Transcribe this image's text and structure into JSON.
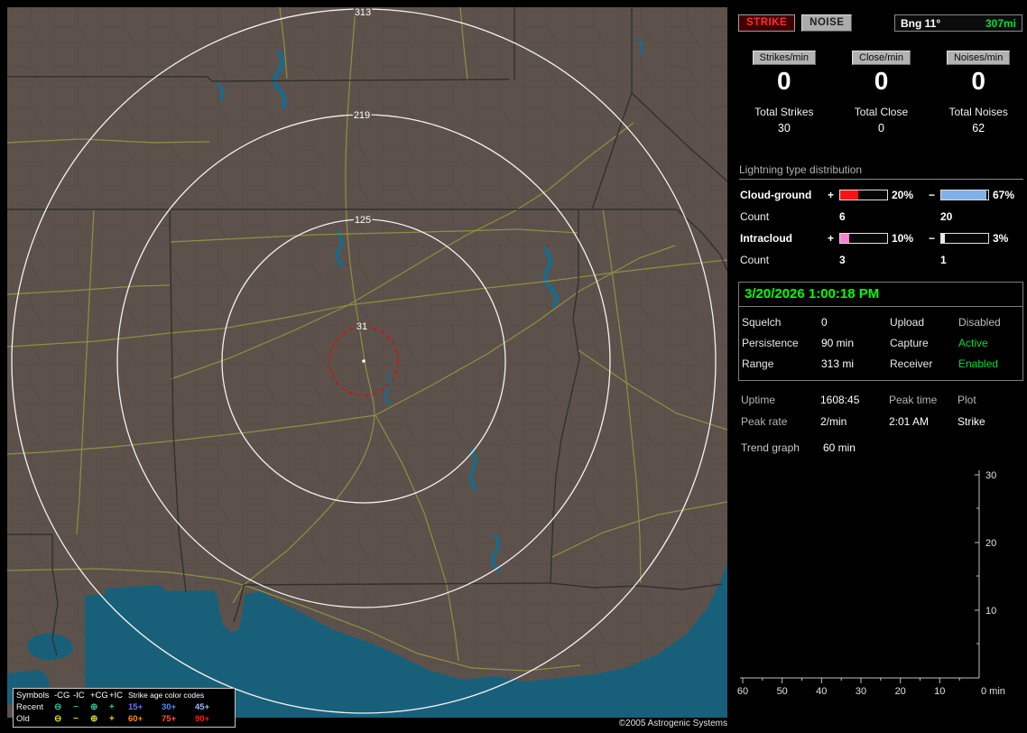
{
  "map": {
    "ring_labels": [
      "313",
      "219",
      "125",
      "31"
    ],
    "copyright": "©2005 Astrogenic Systems",
    "legend": {
      "symbols_header": "Symbols",
      "columns": [
        "-CG",
        "-IC",
        "+CG",
        "+IC"
      ],
      "age_header": "Strike age color codes",
      "symbols": [
        "⊖",
        "−",
        "⊕",
        "+"
      ],
      "rows": [
        {
          "label": "Recent",
          "symbol_color": "#2fbf8f",
          "ages": [
            {
              "text": "15+",
              "color": "#6f6fff"
            },
            {
              "text": "30+",
              "color": "#4a8cff"
            },
            {
              "text": "45+",
              "color": "#9fb9ff"
            }
          ]
        },
        {
          "label": "Old",
          "symbol_color": "#d6d62a",
          "ages": [
            {
              "text": "60+",
              "color": "#ff8c1a"
            },
            {
              "text": "75+",
              "color": "#ff5533"
            },
            {
              "text": "90+",
              "color": "#ff1a1a"
            }
          ]
        }
      ]
    }
  },
  "panel": {
    "strike_button": "STRIKE",
    "noise_button": "NOISE",
    "bearing_label": "Bng 11°",
    "bearing_distance": "307mi",
    "rate_columns": [
      {
        "button": "Strikes/min",
        "value": "0",
        "total_label": "Total Strikes",
        "total_value": "30"
      },
      {
        "button": "Close/min",
        "value": "0",
        "total_label": "Total Close",
        "total_value": "0"
      },
      {
        "button": "Noises/min",
        "value": "0",
        "total_label": "Total Noises",
        "total_value": "62"
      }
    ],
    "distribution": {
      "title": "Lightning type distribution",
      "count_label": "Count",
      "rows": [
        {
          "label": "Cloud-ground",
          "plus": "+",
          "minus": "−",
          "pos_pct": "20%",
          "neg_pct": "67%",
          "pos_count": "6",
          "neg_count": "20",
          "pos_fill": 38,
          "neg_fill": 97,
          "pos_color": "#ff1111",
          "neg_color": "#7fb2e8"
        },
        {
          "label": "Intracloud",
          "plus": "+",
          "minus": "−",
          "pos_pct": "10%",
          "neg_pct": "3%",
          "pos_count": "3",
          "neg_count": "1",
          "pos_fill": 20,
          "neg_fill": 7,
          "pos_color": "#ff7fd4",
          "neg_color": "#e8e8e8"
        }
      ]
    },
    "timestamp": "3/20/2026 1:00:18 PM",
    "settings": {
      "rows": [
        {
          "label1": "Squelch",
          "value1": "0",
          "value1_color": "#ffffff",
          "label2": "Upload",
          "value2": "Disabled",
          "value2_color": "#bdbdbd"
        },
        {
          "label1": "Persistence",
          "value1": "90 min",
          "value1_color": "#ffffff",
          "label2": "Capture",
          "value2": "Active",
          "value2_color": "#00dd33"
        },
        {
          "label1": "Range",
          "value1": "313 mi",
          "value1_color": "#ffffff",
          "label2": "Receiver",
          "value2": "Enabled",
          "value2_color": "#00dd33"
        }
      ]
    },
    "stats": {
      "uptime_label": "Uptime",
      "uptime": "1608:45",
      "peak_time_label": "Peak time",
      "peak_time": "2:01 AM",
      "plot_label": "Plot",
      "plot_value": "Strike",
      "peak_rate_label": "Peak rate",
      "peak_rate": "2/min"
    },
    "trend": {
      "label": "Trend graph",
      "window": "60 min",
      "y_ticks": [
        "30",
        "20",
        "10"
      ],
      "x_ticks": [
        "60",
        "50",
        "40",
        "30",
        "20",
        "10"
      ],
      "origin_label": "0 min"
    }
  }
}
